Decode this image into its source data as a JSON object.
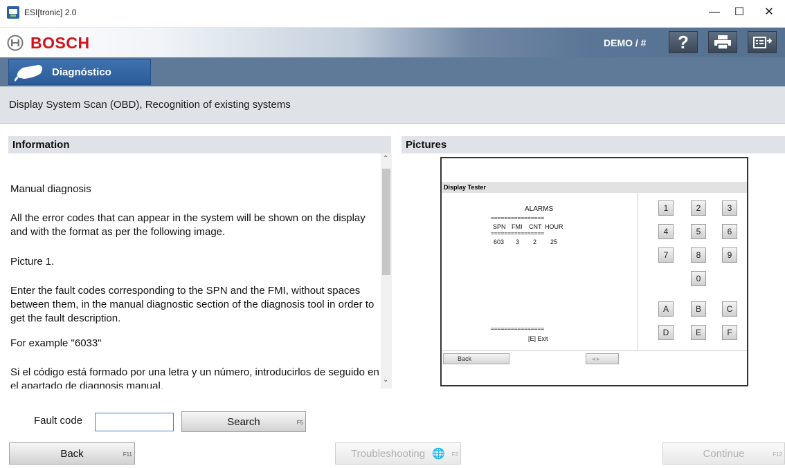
{
  "window": {
    "title": "ESI[tronic] 2.0",
    "controls": [
      "minimize",
      "maximize",
      "close"
    ]
  },
  "brand": {
    "name": "BOSCH",
    "user_label": "DEMO / #",
    "toolbar_icons": [
      "help-icon",
      "print-icon",
      "export-icon"
    ]
  },
  "module_tab": {
    "label": "Diagnóstico"
  },
  "header": {
    "title": "Display System Scan (OBD), Recognition of existing systems"
  },
  "information": {
    "heading": "Information",
    "paragraphs": [
      "Manual diagnosis",
      "All the error codes that can appear in the system will be shown on the display and with the format as per the following image.",
      "Picture 1.",
      "Enter the fault codes corresponding to the SPN and the FMI, without spaces between them, in the manual diagnostic section of the diagnosis tool in order to get the fault description.",
      "For example \"6033\"",
      "Si el código está formado por una letra y un número, introducirlos de seguido en el apartado de diagnosis manual."
    ]
  },
  "pictures": {
    "heading": "Pictures",
    "tester": {
      "title": "Display Tester",
      "alarms_label": "ALARMS",
      "separator": "================",
      "columns": [
        "SPN",
        "FMI",
        "CNT",
        "HOUR"
      ],
      "row": [
        "603",
        "3",
        "2",
        "25"
      ],
      "exit_label": "[E] Exit",
      "keys_numeric": [
        "1",
        "2",
        "3",
        "4",
        "5",
        "6",
        "7",
        "8",
        "9",
        "0"
      ],
      "keys_alpha": [
        "A",
        "B",
        "C",
        "D",
        "E",
        "F"
      ],
      "back_label": "Back"
    }
  },
  "fault": {
    "label": "Fault code",
    "value": "",
    "search_label": "Search",
    "search_fkey": "F5"
  },
  "footer": {
    "back_label": "Back",
    "back_fkey": "F11",
    "troubleshooting_label": "Troubleshooting",
    "troubleshooting_fkey": "F2",
    "continue_label": "Continue",
    "continue_fkey": "F12"
  }
}
